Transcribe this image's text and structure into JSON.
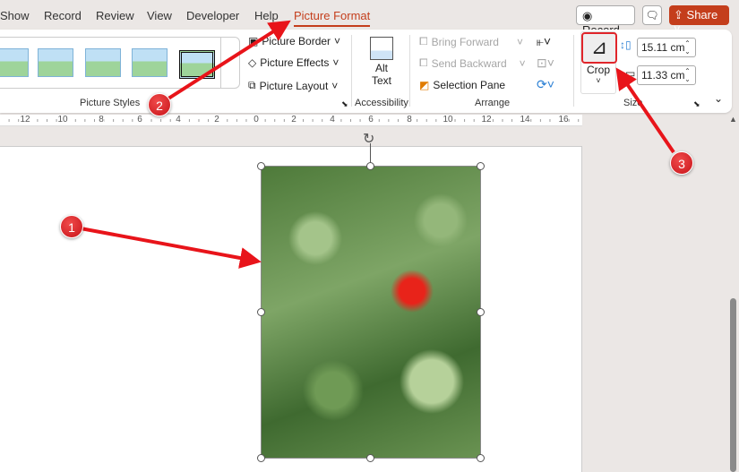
{
  "tabs": [
    {
      "label": "Show"
    },
    {
      "label": "Record"
    },
    {
      "label": "Review"
    },
    {
      "label": "View"
    },
    {
      "label": "Developer"
    },
    {
      "label": "Help"
    },
    {
      "label": "Picture Format",
      "active": true
    }
  ],
  "top_buttons": {
    "record": "Record",
    "share": "Share"
  },
  "accent": "#c43e1c",
  "picture_styles": {
    "label": "Picture Styles",
    "border": "Picture Border",
    "effects": "Picture Effects",
    "layout": "Picture Layout"
  },
  "accessibility": {
    "label": "Accessibility",
    "alt_text_1": "Alt",
    "alt_text_2": "Text"
  },
  "arrange": {
    "label": "Arrange",
    "bring_forward": "Bring Forward",
    "send_backward": "Send Backward",
    "selection_pane": "Selection Pane"
  },
  "size": {
    "label": "Size",
    "crop": "Crop",
    "height": "15.11 cm",
    "width": "11.33 cm"
  },
  "ruler": [
    "12",
    "10",
    "8",
    "6",
    "4",
    "2",
    "0",
    "2",
    "4",
    "6",
    "8",
    "10",
    "12",
    "14",
    "16"
  ],
  "annotations": [
    "1",
    "2",
    "3"
  ]
}
